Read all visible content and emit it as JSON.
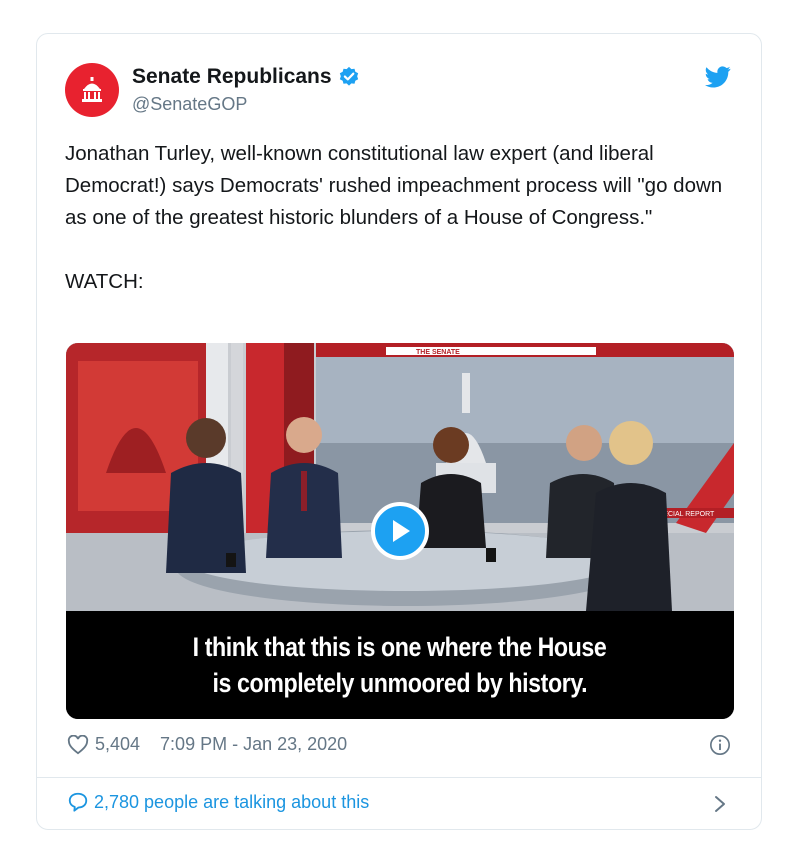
{
  "account": {
    "name": "Senate Republicans",
    "handle": "@SenateGOP"
  },
  "tweet": {
    "text": "Jonathan Turley, well-known constitutional law expert (and liberal Democrat!) says Democrats' rushed impeachment process will \"go down as one of the greatest historic blunders of a House of Congress.\"",
    "watch_label": "WATCH:"
  },
  "media": {
    "caption_line1": "I think that this is one where the House",
    "caption_line2": "is completely unmoored by history.",
    "set_text_top": "THE SENATE",
    "set_text_right": "SPECIAL REPORT"
  },
  "footer": {
    "likes": "5,404",
    "timestamp": "7:09 PM - Jan 23, 2020",
    "talking": "2,780 people are talking about this"
  },
  "icons": {
    "avatar": "capitol-icon",
    "verified": "verified-badge-icon",
    "brand": "twitter-bird-icon",
    "like": "heart-icon",
    "info": "info-icon",
    "reply": "speech-bubble-icon",
    "more": "chevron-right-icon"
  },
  "colors": {
    "brand_red": "#e8222f",
    "twitter_blue": "#1da1f2",
    "link_blue": "#1b95e0",
    "muted_gray": "#657786",
    "border": "#e1e8ed"
  }
}
